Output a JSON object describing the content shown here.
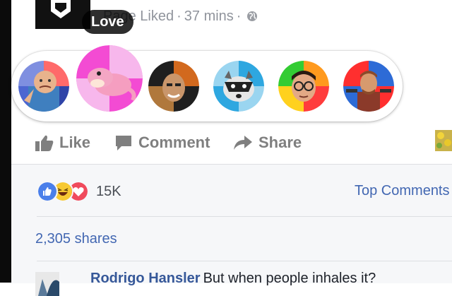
{
  "post_header": {
    "page_name": "Page",
    "action": "Liked",
    "time": "37 mins",
    "separator": "·"
  },
  "tooltip": {
    "label": "Love"
  },
  "reaction_dock": {
    "faces": [
      {
        "name": "success-kid-face",
        "colors": [
          "#ff6666",
          "#4d66d1",
          "#2f44a8",
          "#7f8fe0"
        ]
      },
      {
        "name": "slowpoke-face",
        "colors": [
          "#f34bd3",
          "#f7b7ec"
        ],
        "hovered": true
      },
      {
        "name": "bald-man-face",
        "colors": [
          "#d2691e",
          "#1f1f1f",
          "#b0783c"
        ]
      },
      {
        "name": "raccoon-face",
        "colors": [
          "#2ea7e0",
          "#9ad5f0"
        ]
      },
      {
        "name": "nerd-face",
        "colors": [
          "#ff3c3c",
          "#ff9a1e",
          "#33cc33",
          "#ffd11e"
        ]
      },
      {
        "name": "chuck-norris-face",
        "colors": [
          "#ff2f2f",
          "#2d6bd6"
        ]
      }
    ]
  },
  "actions": {
    "like": "Like",
    "comment": "Comment",
    "share": "Share"
  },
  "stats": {
    "reaction_count": "15K",
    "top_comments": "Top Comments",
    "shares": "2,305 shares"
  },
  "comment": {
    "author": "Rodrigo Hansler",
    "text": "But when people inhales it?"
  },
  "colors": {
    "link_blue": "#4267b2",
    "muted_text": "#90949c",
    "action_gray": "#7f7f7f",
    "stats_bg": "#f6f7f9"
  }
}
